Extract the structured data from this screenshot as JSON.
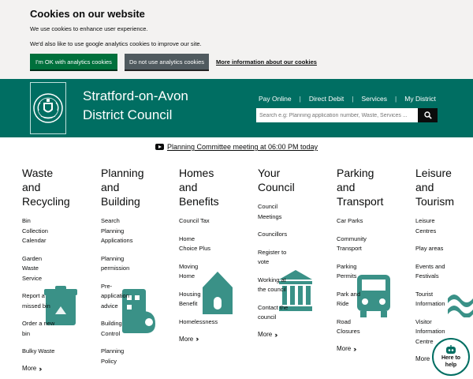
{
  "cookie": {
    "title": "Cookies on our website",
    "line1": "We use cookies to enhance user experience.",
    "line2": "We'd also like to use google analytics cookies to improve our site.",
    "accept_label": "I'm OK with analytics cookies",
    "reject_label": "Do not use analytics cookies",
    "more_label": "More information about our cookies"
  },
  "header": {
    "name_line1": "Stratford-on-Avon",
    "name_line2": "District Council",
    "nav": [
      "Pay Online",
      "Direct Debit",
      "Services",
      "My District"
    ],
    "search_placeholder": "Search e.g: Planning application number, Waste, Services ..."
  },
  "announcement": "Planning Committee meeting at 06:00 PM today",
  "categories": [
    {
      "title": [
        "Waste",
        "and",
        "Recycling"
      ],
      "links": [
        [
          "Bin",
          "Collection",
          "Calendar"
        ],
        [
          "Garden",
          "Waste",
          "Service"
        ],
        [
          "Report a",
          "missed bin"
        ],
        [
          "Order a new",
          "bin"
        ],
        [
          "Bulky Waste"
        ]
      ],
      "more": "More"
    },
    {
      "title": [
        "Planning",
        "and",
        "Building"
      ],
      "links": [
        [
          "Search",
          "Planning",
          "Applications"
        ],
        [
          "Planning",
          "permission"
        ],
        [
          "Pre-",
          "application",
          "advice"
        ],
        [
          "Building",
          "Control"
        ],
        [
          "Planning",
          "Policy"
        ]
      ],
      "more": ""
    },
    {
      "title": [
        "Homes",
        "and",
        "Benefits"
      ],
      "links": [
        [
          "Council Tax"
        ],
        [
          "Home",
          "Choice Plus"
        ],
        [
          "Moving",
          "Home"
        ],
        [
          "Housing",
          "Benefit"
        ],
        [
          "Homelessness"
        ]
      ],
      "more": "More"
    },
    {
      "title": [
        "Your",
        "Council"
      ],
      "links": [
        [
          "Council",
          "Meetings"
        ],
        [
          "Councillors"
        ],
        [
          "Register to",
          "vote"
        ],
        [
          "Working at",
          "the council"
        ],
        [
          "Contact the",
          "council"
        ]
      ],
      "more": "More"
    },
    {
      "title": [
        "Parking",
        "and",
        "Transport"
      ],
      "links": [
        [
          "Car Parks"
        ],
        [
          "Community",
          "Transport"
        ],
        [
          "Parking",
          "Permits"
        ],
        [
          "Park and",
          "Ride"
        ],
        [
          "Road",
          "Closures"
        ]
      ],
      "more": "More"
    },
    {
      "title": [
        "Leisure",
        "and",
        "Tourism"
      ],
      "links": [
        [
          "Leisure",
          "Centres"
        ],
        [
          "Play areas"
        ],
        [
          "Events and",
          "Festivals"
        ],
        [
          "Tourist",
          "Information"
        ],
        [
          "Visitor",
          "Information",
          "Centre"
        ]
      ],
      "more": "More"
    }
  ],
  "help": {
    "line1": "Here to",
    "line2": "help"
  },
  "colors": {
    "brand": "#006e62",
    "accept": "#00703c",
    "reject": "#505a5f",
    "icon": "#3a9187"
  }
}
